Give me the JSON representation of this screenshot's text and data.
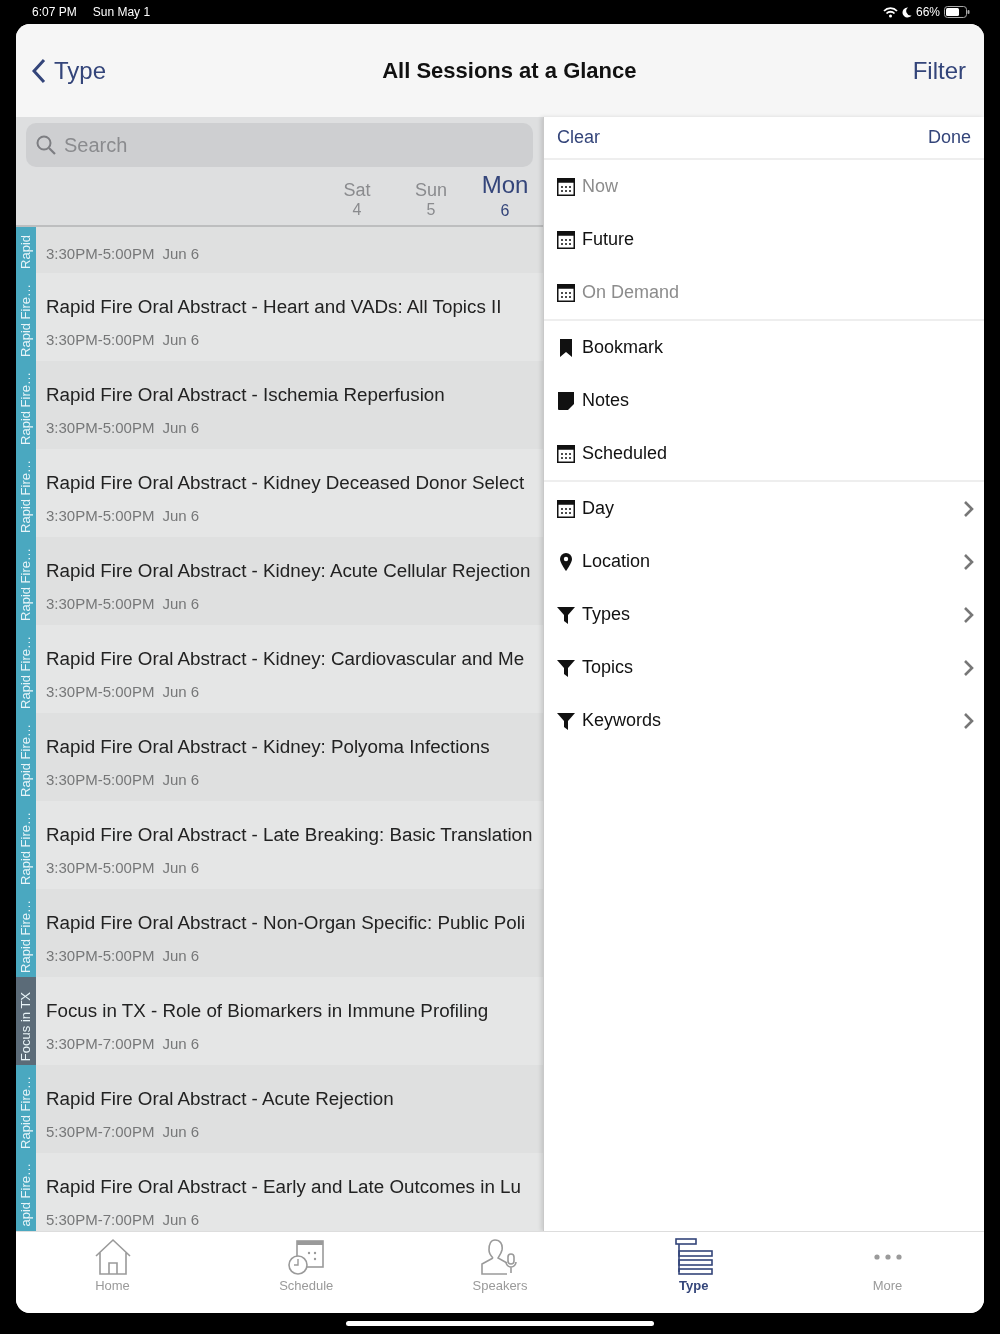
{
  "status_bar": {
    "time": "6:07 PM",
    "date": "Sun May 1",
    "battery": "66%"
  },
  "nav": {
    "back": "Type",
    "title": "All Sessions at a Glance",
    "action": "Filter"
  },
  "search": {
    "placeholder": "Search"
  },
  "days": [
    {
      "label": "Sat",
      "number": "4",
      "selected": false
    },
    {
      "label": "Sun",
      "number": "5",
      "selected": false
    },
    {
      "label": "Mon",
      "number": "6",
      "selected": true
    }
  ],
  "sessions": [
    {
      "track": "Rapid",
      "color": "#4aa8c0",
      "time": "3:30PM-5:00PM",
      "date": "Jun 6"
    },
    {
      "track": "Rapid Fire…",
      "color": "#4aa8c0",
      "title": "Rapid Fire Oral Abstract - Heart and VADs: All Topics II",
      "time": "3:30PM-5:00PM",
      "date": "Jun 6"
    },
    {
      "track": "Rapid Fire…",
      "color": "#4aa8c0",
      "title": "Rapid Fire Oral Abstract - Ischemia Reperfusion",
      "time": "3:30PM-5:00PM",
      "date": "Jun 6"
    },
    {
      "track": "Rapid Fire…",
      "color": "#4aa8c0",
      "title": "Rapid Fire Oral Abstract - Kidney Deceased Donor Select",
      "time": "3:30PM-5:00PM",
      "date": "Jun 6"
    },
    {
      "track": "Rapid Fire…",
      "color": "#4aa8c0",
      "title": "Rapid Fire Oral Abstract - Kidney: Acute Cellular Rejection",
      "time": "3:30PM-5:00PM",
      "date": "Jun 6"
    },
    {
      "track": "Rapid Fire…",
      "color": "#4aa8c0",
      "title": "Rapid Fire Oral Abstract - Kidney: Cardiovascular and Me",
      "time": "3:30PM-5:00PM",
      "date": "Jun 6"
    },
    {
      "track": "Rapid Fire…",
      "color": "#4aa8c0",
      "title": "Rapid Fire Oral Abstract - Kidney: Polyoma Infections",
      "time": "3:30PM-5:00PM",
      "date": "Jun 6"
    },
    {
      "track": "Rapid Fire…",
      "color": "#4aa8c0",
      "title": "Rapid Fire Oral Abstract - Late Breaking: Basic Translation",
      "time": "3:30PM-5:00PM",
      "date": "Jun 6"
    },
    {
      "track": "Rapid Fire…",
      "color": "#4aa8c0",
      "title": "Rapid Fire Oral Abstract - Non-Organ Specific: Public Poli",
      "time": "3:30PM-5:00PM",
      "date": "Jun 6"
    },
    {
      "track": "Focus in TX",
      "color": "#5b6b78",
      "title": "Focus in TX - Role of Biomarkers in Immune Profiling",
      "time": "3:30PM-7:00PM",
      "date": "Jun 6"
    },
    {
      "track": "Rapid Fire…",
      "color": "#4aa8c0",
      "title": "Rapid Fire Oral Abstract - Acute Rejection",
      "time": "5:30PM-7:00PM",
      "date": "Jun 6"
    },
    {
      "track": "apid Fire…",
      "color": "#4aa8c0",
      "title": "Rapid Fire Oral Abstract - Early and Late Outcomes in Lu",
      "time": "5:30PM-7:00PM",
      "date": "Jun 6"
    }
  ],
  "filter": {
    "clear": "Clear",
    "done": "Done",
    "sections": [
      {
        "items": [
          {
            "kind": "calendar",
            "label": "Now",
            "disabled": true,
            "chevron": false
          },
          {
            "kind": "calendar",
            "label": "Future",
            "disabled": false,
            "chevron": false
          },
          {
            "kind": "calendar",
            "label": "On Demand",
            "disabled": true,
            "chevron": false
          }
        ]
      },
      {
        "items": [
          {
            "kind": "bookmark",
            "label": "Bookmark",
            "disabled": false,
            "chevron": false
          },
          {
            "kind": "note",
            "label": "Notes",
            "disabled": false,
            "chevron": false
          },
          {
            "kind": "calendar",
            "label": "Scheduled",
            "disabled": false,
            "chevron": false
          }
        ]
      },
      {
        "items": [
          {
            "kind": "calendar",
            "label": "Day",
            "disabled": false,
            "chevron": true
          },
          {
            "kind": "pin",
            "label": "Location",
            "disabled": false,
            "chevron": true
          },
          {
            "kind": "funnel",
            "label": "Types",
            "disabled": false,
            "chevron": true
          },
          {
            "kind": "funnel",
            "label": "Topics",
            "disabled": false,
            "chevron": true
          },
          {
            "kind": "funnel",
            "label": "Keywords",
            "disabled": false,
            "chevron": true
          }
        ]
      }
    ]
  },
  "tab_bar": [
    {
      "kind": "home",
      "label": "Home",
      "selected": false
    },
    {
      "kind": "schedule",
      "label": "Schedule",
      "selected": false
    },
    {
      "kind": "speakers",
      "label": "Speakers",
      "selected": false
    },
    {
      "kind": "type",
      "label": "Type",
      "selected": true
    },
    {
      "kind": "more",
      "label": "More",
      "selected": false
    }
  ]
}
